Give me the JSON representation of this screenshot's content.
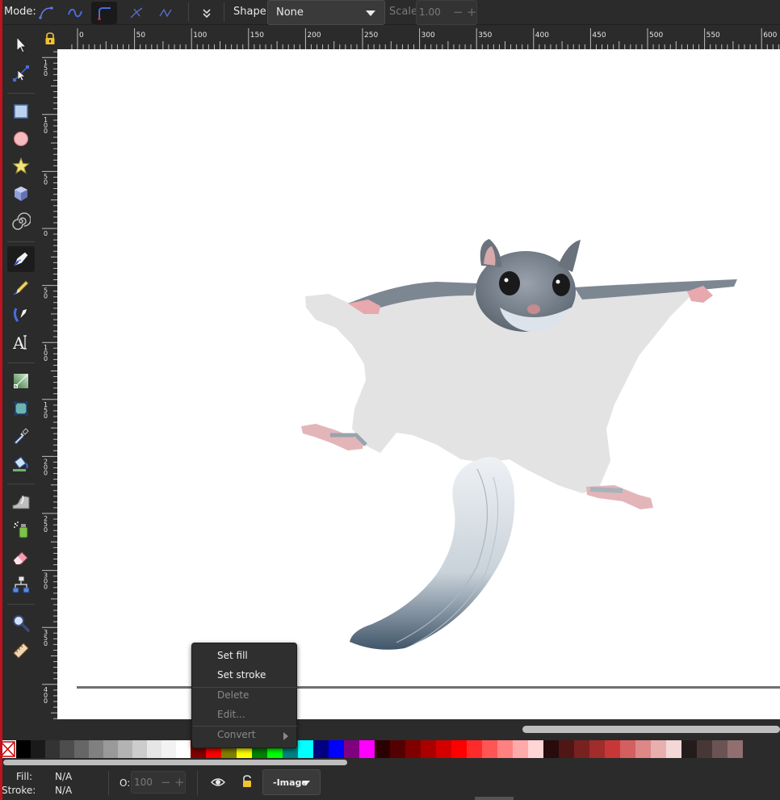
{
  "toolbar": {
    "mode_label": "Mode:",
    "shape_label": "Shape:",
    "shape_value": "None",
    "scale_label": "Scale:",
    "scale_value": "1.00",
    "minus": "−",
    "plus": "+",
    "mode_buttons": [
      "regular-bezier-icon",
      "spiro-path-icon",
      "bspline-path-icon",
      "paraxial-icon",
      "sequence-of-segments-icon"
    ],
    "overflow_icon": "chevron-double-down-icon"
  },
  "tools": [
    {
      "name": "selector-tool",
      "icon": "arrow-pointer-icon"
    },
    {
      "name": "node-tool",
      "icon": "node-edit-icon"
    },
    {
      "name": "rectangle-tool",
      "icon": "rectangle-icon"
    },
    {
      "name": "ellipse-tool",
      "icon": "circle-icon"
    },
    {
      "name": "star-tool",
      "icon": "star-icon"
    },
    {
      "name": "3d-box-tool",
      "icon": "cube-icon"
    },
    {
      "name": "spiral-tool",
      "icon": "spiral-icon"
    },
    {
      "name": "pen-tool",
      "icon": "pen-icon",
      "active": true
    },
    {
      "name": "pencil-tool",
      "icon": "pencil-icon"
    },
    {
      "name": "calligraphy-tool",
      "icon": "calligraphy-pen-icon"
    },
    {
      "name": "text-tool",
      "icon": "text-icon"
    },
    {
      "name": "gradient-tool",
      "icon": "gradient-icon"
    },
    {
      "name": "mesh-tool",
      "icon": "mesh-icon"
    },
    {
      "name": "dropper-tool",
      "icon": "dropper-icon"
    },
    {
      "name": "paint-bucket-tool",
      "icon": "paint-bucket-icon"
    },
    {
      "name": "tweak-tool",
      "icon": "tweak-icon"
    },
    {
      "name": "spray-tool",
      "icon": "spray-icon"
    },
    {
      "name": "eraser-tool",
      "icon": "eraser-icon"
    },
    {
      "name": "connector-tool",
      "icon": "connector-icon"
    },
    {
      "name": "zoom-tool",
      "icon": "magnifier-icon"
    },
    {
      "name": "measure-tool",
      "icon": "ruler-icon"
    }
  ],
  "ruler": {
    "h_labels": [
      "0",
      "50",
      "100",
      "150",
      "200",
      "250",
      "300",
      "350",
      "400",
      "450",
      "500",
      "550",
      "600"
    ],
    "v_labels": [
      "150",
      "100",
      "50",
      "0",
      "50",
      "100",
      "150",
      "200",
      "250",
      "300",
      "350",
      "400"
    ]
  },
  "context_menu": {
    "set_fill": "Set fill",
    "set_stroke": "Set stroke",
    "delete": "Delete",
    "edit": "Edit...",
    "convert": "Convert"
  },
  "palette": {
    "none_swatch": "none-swatch-icon",
    "colors": [
      "#000000",
      "#1a1a1a",
      "#333333",
      "#4d4d4d",
      "#666666",
      "#808080",
      "#999999",
      "#b3b3b3",
      "#cccccc",
      "#e6e6e6",
      "#f2f2f2",
      "#ffffff",
      "#800000",
      "#ff0000",
      "#808000",
      "#ffff00",
      "#008000",
      "#00ff00",
      "#008080",
      "#00ffff",
      "#000080",
      "#0000ff",
      "#800080",
      "#ff00ff",
      "#2b0000",
      "#550000",
      "#800000",
      "#aa0000",
      "#d40000",
      "#ff0000",
      "#ff2a2a",
      "#ff5555",
      "#ff8080",
      "#ffaaaa",
      "#ffd5d5",
      "#280b0b",
      "#501616",
      "#782121",
      "#a02c2c",
      "#c83737",
      "#d35f5f",
      "#de8787",
      "#e9afaf",
      "#f4d7d7",
      "#241c1c",
      "#483737",
      "#6c5353",
      "#916f6f"
    ]
  },
  "status": {
    "fill_label": "Fill:",
    "fill_value": "N/A",
    "stroke_label": "Stroke:",
    "stroke_value": "N/A",
    "opacity_label": "O:",
    "opacity_value": "100",
    "layer_value": "-Image"
  },
  "colors": {
    "background": "#2b2b2b",
    "accent_red": "#c1121f",
    "canvas": "#ffffff"
  }
}
